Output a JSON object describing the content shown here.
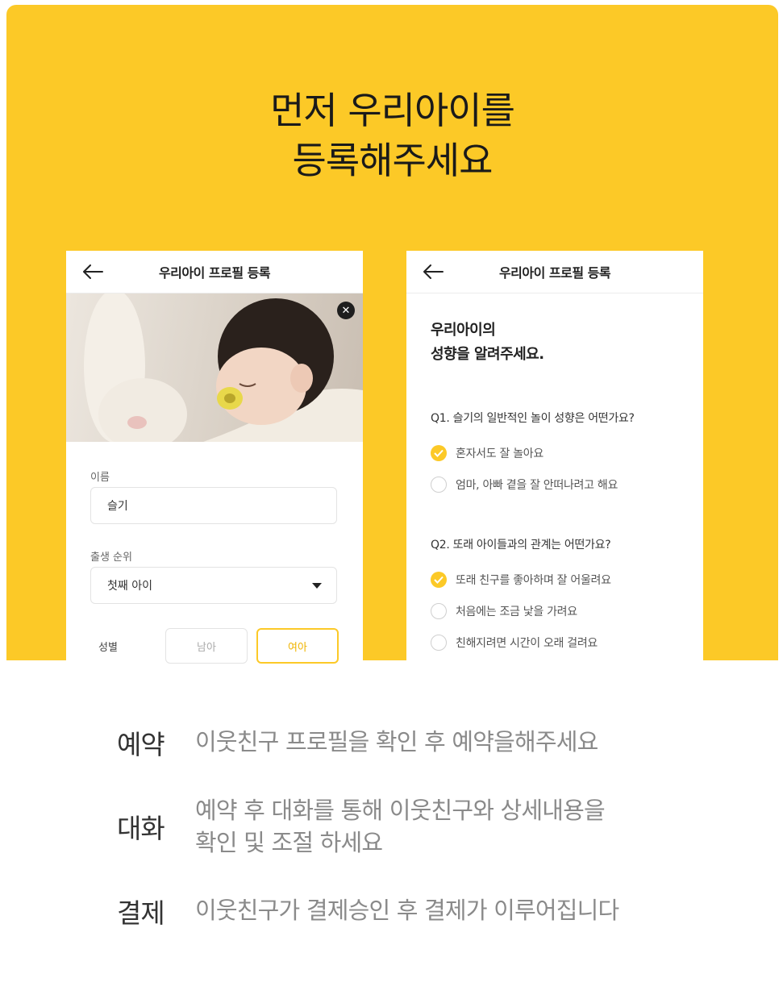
{
  "headline": {
    "line1": "먼저 우리아이를",
    "line2": "등록해주세요"
  },
  "colors": {
    "brand_yellow": "#fcc927",
    "selected_text": "#f0b400",
    "checked_radio": "#fcc927"
  },
  "screen_profile": {
    "title": "우리아이 프로필 등록",
    "back_icon": "arrow-left-icon",
    "photo_close_icon": "close-icon",
    "name_label": "이름",
    "name_value": "슬기",
    "birth_order_label": "출생 순위",
    "birth_order_value": "첫째 아이",
    "gender_label": "성별",
    "gender_options": [
      "남아",
      "여아"
    ],
    "gender_selected": "여아"
  },
  "screen_personality": {
    "title": "우리아이 프로필 등록",
    "heading_line1": "우리아이의",
    "heading_line2": "성향을 알려주세요.",
    "questions": [
      {
        "question": "Q1. 슬기의 일반적인 놀이 성향은 어떤가요?",
        "options": [
          {
            "label": "혼자서도 잘 놀아요",
            "checked": true
          },
          {
            "label": "엄마, 아빠 곁을 잘 안떠나려고 해요",
            "checked": false
          }
        ]
      },
      {
        "question": "Q2. 또래 아이들과의 관계는 어떤가요?",
        "options": [
          {
            "label": "또래 친구를 좋아하며 잘 어울려요",
            "checked": true
          },
          {
            "label": "처음에는 조금 낯을 가려요",
            "checked": false
          },
          {
            "label": "친해지려면 시간이 오래 걸려요",
            "checked": false
          }
        ]
      }
    ]
  },
  "steps": [
    {
      "key": "예약",
      "desc_line1": "이웃친구 프로필을 확인 후 예약을해주세요",
      "desc_line2": ""
    },
    {
      "key": "대화",
      "desc_line1": "예약 후 대화를 통해 이웃친구와 상세내용을",
      "desc_line2": "확인 및 조절 하세요"
    },
    {
      "key": "결제",
      "desc_line1": "이웃친구가 결제승인 후 결제가 이루어집니다",
      "desc_line2": ""
    }
  ]
}
